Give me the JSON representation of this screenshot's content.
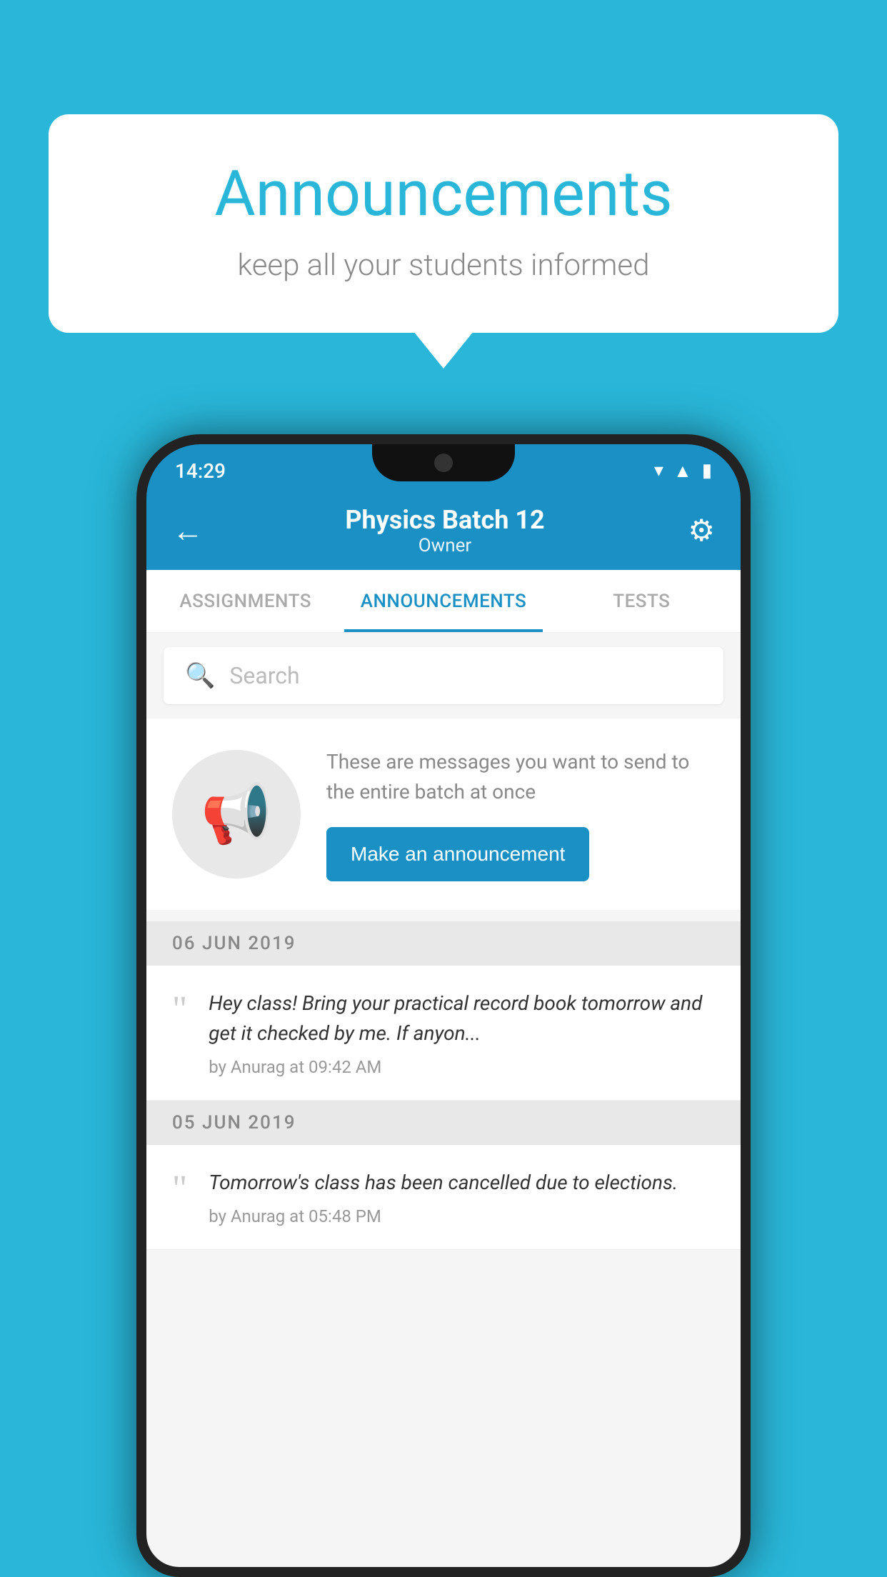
{
  "background_color": "#29b6d8",
  "speech_bubble": {
    "title": "Announcements",
    "subtitle": "keep all your students informed"
  },
  "status_bar": {
    "time": "14:29",
    "wifi": "▾",
    "signal": "▲",
    "battery": "▮"
  },
  "app_bar": {
    "title": "Physics Batch 12",
    "subtitle": "Owner",
    "back_label": "←",
    "settings_label": "⚙"
  },
  "tabs": [
    {
      "label": "ASSIGNMENTS",
      "active": false
    },
    {
      "label": "ANNOUNCEMENTS",
      "active": true
    },
    {
      "label": "TESTS",
      "active": false
    }
  ],
  "search": {
    "placeholder": "Search"
  },
  "empty_state": {
    "description": "These are messages you want to send to the entire batch at once",
    "button_label": "Make an announcement"
  },
  "announcements": [
    {
      "date": "06  JUN  2019",
      "text": "Hey class! Bring your practical record book tomorrow and get it checked by me. If anyon...",
      "meta": "by Anurag at 09:42 AM"
    },
    {
      "date": "05  JUN  2019",
      "text": "Tomorrow's class has been cancelled due to elections.",
      "meta": "by Anurag at 05:48 PM"
    }
  ]
}
